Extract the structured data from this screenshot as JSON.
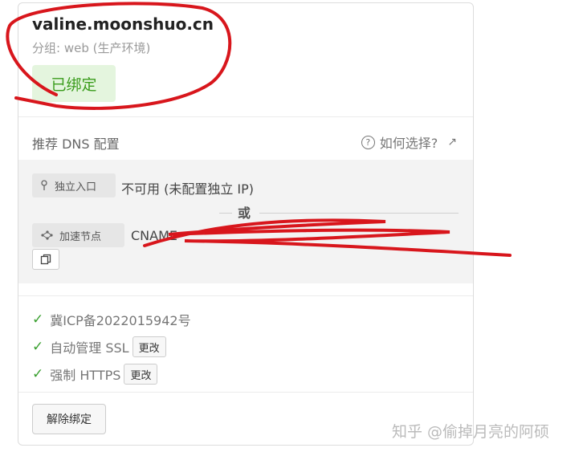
{
  "card": {
    "domain": "valine.moonshuo.cn",
    "group": "分组: web (生产环境)",
    "bound_badge": "已绑定"
  },
  "dns": {
    "label": "推荐 DNS 配置",
    "help_link": "如何选择?",
    "help_icon": "question-circle-icon",
    "external_icon": "external-link-icon",
    "ip_tag": "独立入口",
    "ip_icon": "location-pin-icon",
    "ip_value": "不可用 (未配置独立 IP)",
    "or_text": "或",
    "accel_tag": "加速节点",
    "accel_icon": "network-nodes-icon",
    "cname_value": "CNAME",
    "copy_icon": "copy-icon"
  },
  "status": {
    "icp": "冀ICP备2022015942号",
    "ssl": "自动管理 SSL",
    "https": "强制 HTTPS",
    "change_label": "更改",
    "check_icon": "check-icon",
    "check_color": "#3aa030"
  },
  "actions": {
    "unbind": "解除绑定"
  },
  "watermark": "知乎 @偷掉月亮的阿硕",
  "colors": {
    "annotation_red": "#d8161c",
    "badge_green": "#3a9c1c",
    "badge_bg": "#e4f5de"
  }
}
